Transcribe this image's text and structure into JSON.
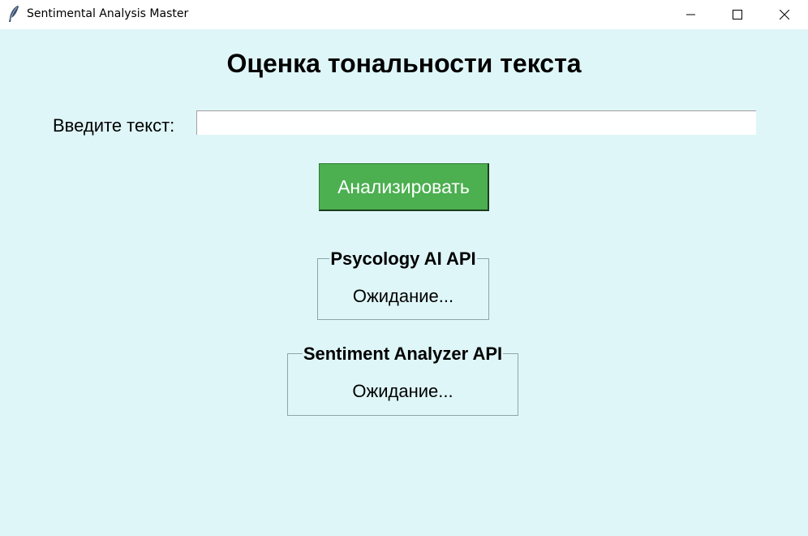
{
  "window": {
    "title": "Sentimental Analysis Master",
    "background_color": "#dff6f8",
    "icon": "feather-icon"
  },
  "controls": {
    "minimize_icon": "minimize-icon",
    "maximize_icon": "maximize-icon",
    "close_icon": "close-icon"
  },
  "main": {
    "heading": "Оценка тональности текста",
    "input_label": "Введите текст:",
    "input_value": "",
    "input_placeholder": "",
    "analyze_button_label": "Анализировать",
    "analyze_button_color": "#4caf50"
  },
  "results": [
    {
      "title": "Psycology AI API",
      "status": "Ожидание..."
    },
    {
      "title": "Sentiment Analyzer API",
      "status": "Ожидание..."
    }
  ]
}
